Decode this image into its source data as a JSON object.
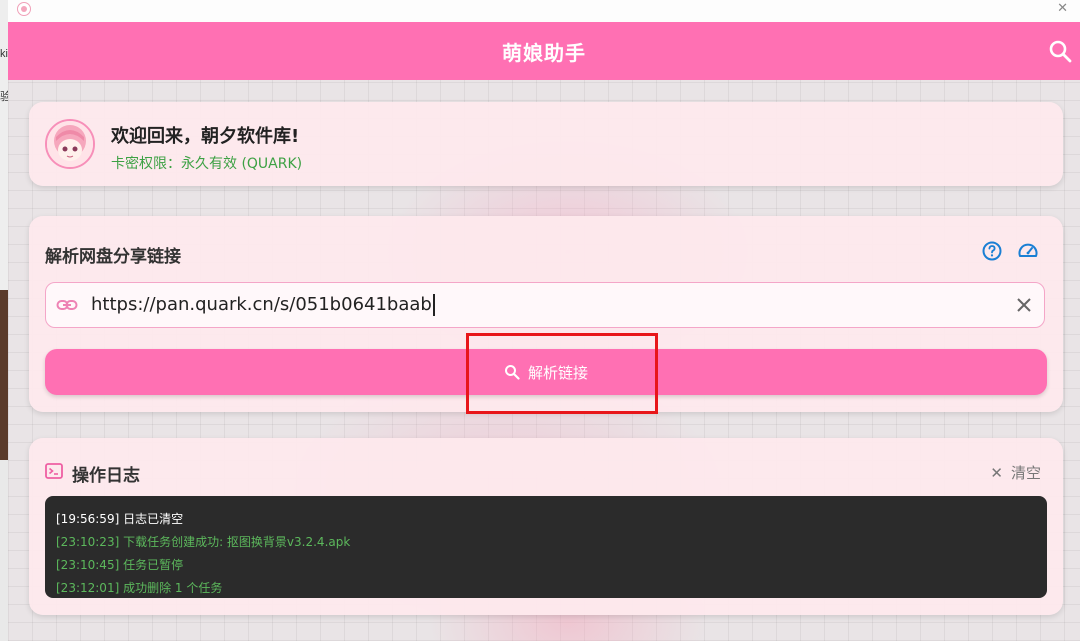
{
  "app": {
    "title": "萌娘助手"
  },
  "user": {
    "welcome": "欢迎回来，朝夕软件库!",
    "permission": "卡密权限：永久有效 (QUARK)"
  },
  "parse": {
    "title": "解析网盘分享链接",
    "url_value": "https://pan.quark.cn/s/051b0641baab",
    "button_label": "解析链接"
  },
  "log": {
    "title": "操作日志",
    "clear_label": "清空",
    "lines": [
      "[19:56:59] 日志已清空",
      "[23:10:23] 下载任务创建成功: 抠图换背景v3.2.4.apk",
      "[23:10:45] 任务已暂停",
      "[23:12:01] 成功删除 1 个任务"
    ]
  },
  "colors": {
    "primary": "#ff70b3",
    "card": "#fde8ec",
    "success": "#3da144",
    "log_bg": "#2b2b2b",
    "highlight": "#e8161a",
    "icon_blue": "#1a7fd4"
  },
  "icons": {
    "search": "search-icon",
    "help": "help-circle-icon",
    "speedometer": "speedometer-icon",
    "link": "link-icon",
    "clear": "close-icon",
    "terminal": "terminal-icon"
  }
}
